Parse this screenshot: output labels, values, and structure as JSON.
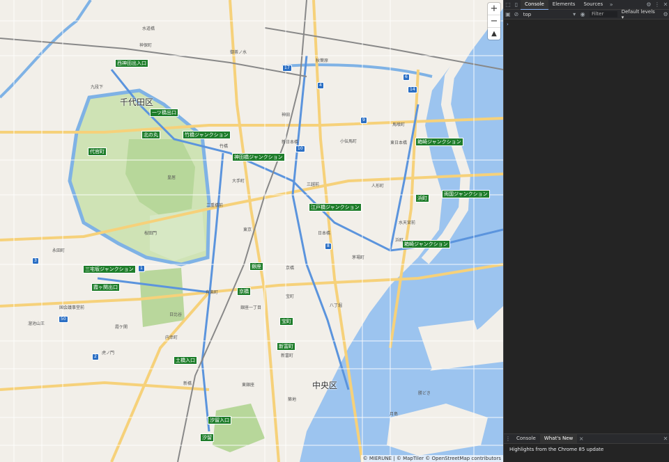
{
  "map": {
    "ward_labels": [
      "千代田区",
      "中央区"
    ],
    "junctions": [
      "一ツ橋出口",
      "竹橋ジャンクション",
      "代官町",
      "北の丸",
      "神田橋ジャンクション",
      "江戸橋ジャンクション",
      "箱崎ジャンクション",
      "浜町",
      "汐留",
      "土橋入口",
      "京橋",
      "銀座",
      "三宅坂ジャンクション",
      "霞ヶ関出口",
      "西神田出入口",
      "両国ジャンクション",
      "箱崎ジャンクション",
      "宝町",
      "新富町",
      "汐留入口"
    ],
    "place_labels": [
      "皇居",
      "東京",
      "有楽町",
      "日本橋",
      "新日本橋",
      "大手町",
      "神田",
      "秋葉原",
      "人形町",
      "八丁堀",
      "築地",
      "新橋",
      "虎ノ門",
      "霞ケ関",
      "日比谷",
      "茅場町",
      "浜町",
      "月島",
      "勝どき",
      "神保町",
      "御茶ノ水",
      "馬喰町",
      "東日本橋",
      "小伝馬町",
      "水天宮前",
      "桜田門",
      "永田町",
      "国会議事堂前",
      "溜池山王",
      "内幸町",
      "銀座一丁目",
      "宝町",
      "新富町",
      "東銀座",
      "水道橋",
      "九段下",
      "竹橋",
      "二重橋前",
      "京橋",
      "三越前"
    ],
    "route_shields": [
      "17",
      "4",
      "14",
      "6",
      "1",
      "9",
      "2",
      "3",
      "10",
      "50",
      "8"
    ],
    "zoom_in": "+",
    "zoom_out": "−",
    "compass": "▲",
    "attribution": "© MIERUNE | © MapTiler © OpenStreetMap contributors"
  },
  "devtools": {
    "tabs": [
      {
        "label": "Console",
        "active": true
      },
      {
        "label": "Elements",
        "active": false
      },
      {
        "label": "Sources",
        "active": false
      }
    ],
    "more_tabs": "»",
    "context": "top",
    "filter_placeholder": "Filter",
    "levels": "Default levels ▾",
    "prompt": "›",
    "drawer_tabs": [
      {
        "label": "Console",
        "active": false
      },
      {
        "label": "What's New",
        "active": true
      }
    ],
    "whats_new": "Highlights from the Chrome 85 update",
    "colors": {
      "panel": "#242424",
      "tabbar": "#292a2d",
      "accent": "#8ab4f8"
    }
  }
}
